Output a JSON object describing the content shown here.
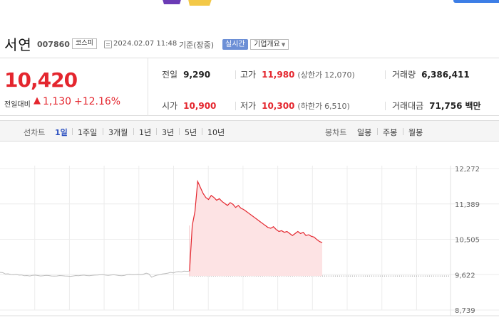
{
  "stock": {
    "name": "서연",
    "code": "007860",
    "market": "코스피",
    "timestamp": "2024.02.07 11:48",
    "basis": "기준(장중)",
    "realtime_label": "실시간",
    "company_info_label": "기업개요"
  },
  "quote": {
    "price": "10,420",
    "change_label": "전일대비",
    "change_arrow": "▲",
    "change_value": "1,130",
    "change_rate": "+12.16%",
    "prev_close_label": "전일",
    "prev_close": "9,290",
    "high_label": "고가",
    "high": "11,980",
    "upper_limit_label": "(상한가",
    "upper_limit": "12,070)",
    "volume_label": "거래량",
    "volume": "6,386,411",
    "open_label": "시가",
    "open": "10,900",
    "low_label": "저가",
    "low": "10,300",
    "lower_limit_label": "(하한가",
    "lower_limit": "6,510)",
    "trade_value_label": "거래대금",
    "trade_value": "71,756",
    "trade_value_unit": "백만"
  },
  "tabs": {
    "line_chart_label": "선차트",
    "periods": [
      "1일",
      "1주일",
      "3개월",
      "1년",
      "3년",
      "5년",
      "10년"
    ],
    "active_period": "1일",
    "candle_chart_label": "봉차트",
    "candles": [
      "일봉",
      "주봉",
      "월봉"
    ]
  },
  "colors": {
    "up": "#e4262e",
    "accent": "#2a4fc0",
    "fill": "#fde3e4",
    "prev_line": "#bbbbbb"
  },
  "chart_data": {
    "type": "line",
    "y_ticks": [
      "12,272",
      "11,389",
      "10,505",
      "9,622",
      "8,739"
    ],
    "ylim": [
      8739,
      12272
    ],
    "reference_value": 9290,
    "series": [
      {
        "values": [
          9680,
          9672,
          9640,
          9645,
          9625,
          9620,
          9630,
          9610,
          9615,
          9595,
          9600,
          9590,
          9605,
          9610,
          9600,
          9590,
          9595,
          9605,
          9600,
          9590,
          9585,
          9590,
          9600,
          9595,
          9590,
          9585,
          9580,
          9590,
          9600,
          9595,
          9605,
          9610,
          9600,
          9595,
          9605,
          9610,
          9615,
          9620,
          9625,
          9610,
          9605,
          9615,
          9620,
          9610,
          9600,
          9595,
          9605,
          9625,
          9630,
          9620,
          9625,
          9630,
          9620,
          9635,
          9660,
          9640,
          9560,
          9590,
          9610,
          9620,
          9640,
          9650,
          9660,
          9680,
          9665,
          9690,
          9700,
          9690,
          9710,
          9705,
          9710,
          10850,
          11200,
          11950,
          11800,
          11650,
          11550,
          11500,
          11600,
          11550,
          11480,
          11520,
          11450,
          11400,
          11350,
          11420,
          11380,
          11300,
          11350,
          11280,
          11250,
          11200,
          11150,
          11100,
          11050,
          11000,
          10950,
          10900,
          10850,
          10800,
          10780,
          10820,
          10750,
          10700,
          10720,
          10680,
          10700,
          10650,
          10600,
          10650,
          10700,
          10650,
          10680,
          10600,
          10620,
          10580,
          10560,
          10500,
          10450,
          10420
        ]
      }
    ]
  }
}
